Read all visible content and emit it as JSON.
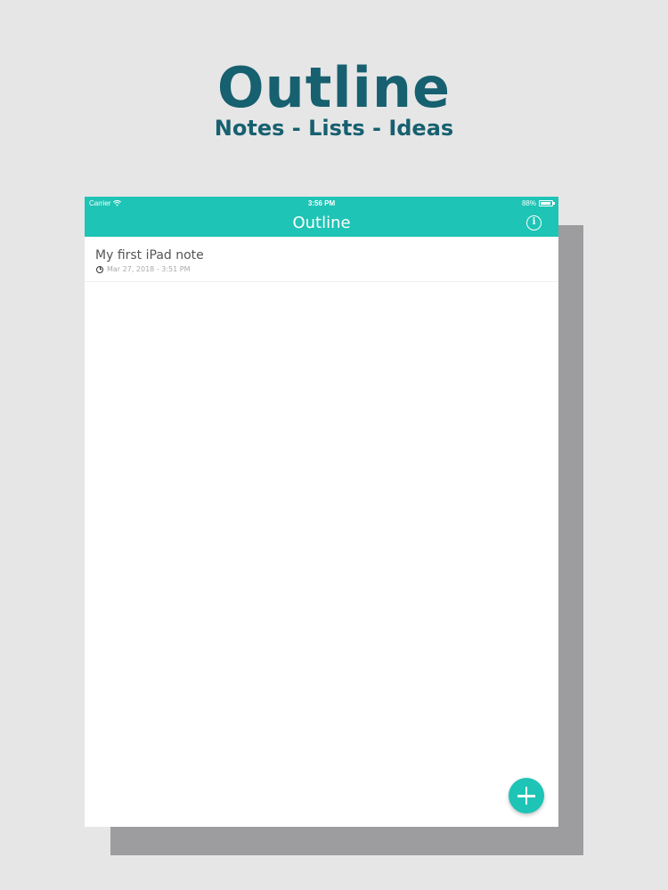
{
  "promo": {
    "title": "Outline",
    "subtitle": "Notes - Lists - Ideas"
  },
  "status_bar": {
    "carrier": "Carrier",
    "time": "3:56 PM",
    "battery": "88%",
    "battery_level": 0.88
  },
  "nav": {
    "title": "Outline",
    "info_icon": "info-icon"
  },
  "notes": [
    {
      "title": "My first iPad note",
      "date": "Mar 27, 2018 - 3:51 PM"
    }
  ],
  "fab": {
    "icon": "plus-icon"
  },
  "colors": {
    "accent": "#1ec4b5",
    "promo_text": "#17606f",
    "background": "#e6e6e7",
    "shadow": "#9d9c9e"
  }
}
